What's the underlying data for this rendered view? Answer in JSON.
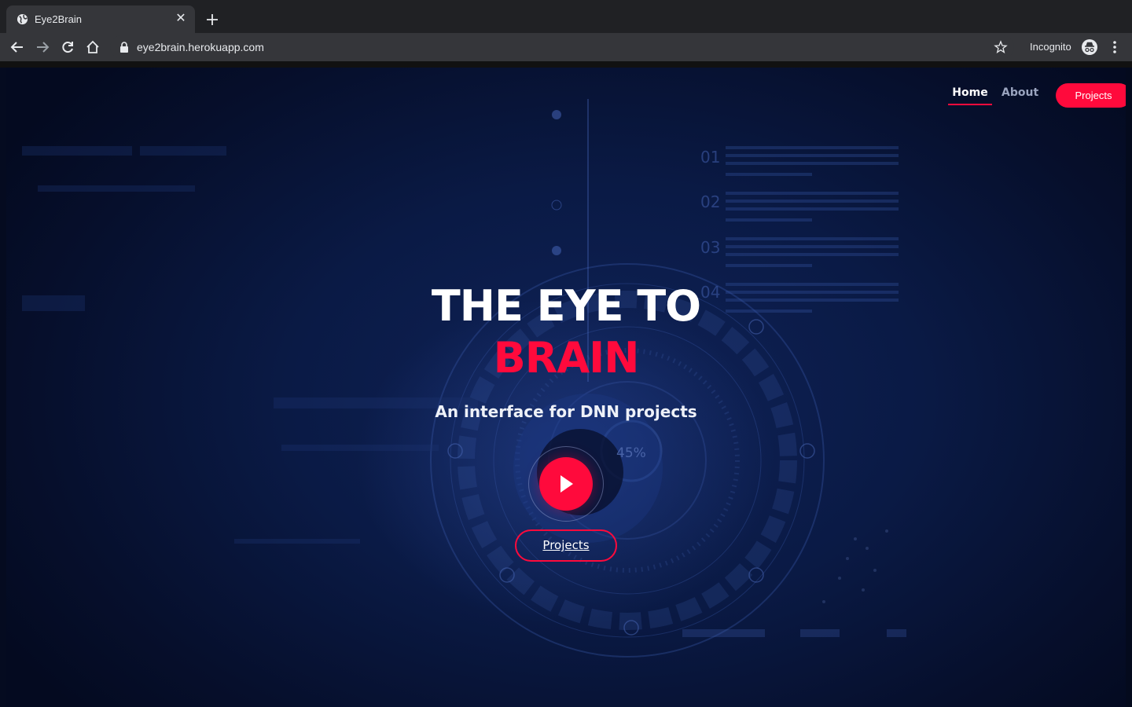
{
  "browser": {
    "tab_title": "Eye2Brain",
    "url": "eye2brain.herokuapp.com",
    "mode_label": "Incognito"
  },
  "nav": {
    "items": [
      {
        "label": "Home",
        "active": true
      },
      {
        "label": "About",
        "active": false
      }
    ],
    "cta_label": "Projects"
  },
  "hero": {
    "title_line1": "THE EYE TO",
    "title_line2": "BRAIN",
    "subtitle": "An interface for DNN projects",
    "button_label": "Projects"
  },
  "background": {
    "row_labels": [
      "01",
      "02",
      "03",
      "04"
    ],
    "percent": "45%"
  },
  "colors": {
    "accent": "#ff0a3c",
    "bg_dark": "#060f2c",
    "bg_mid": "#0f2257"
  }
}
